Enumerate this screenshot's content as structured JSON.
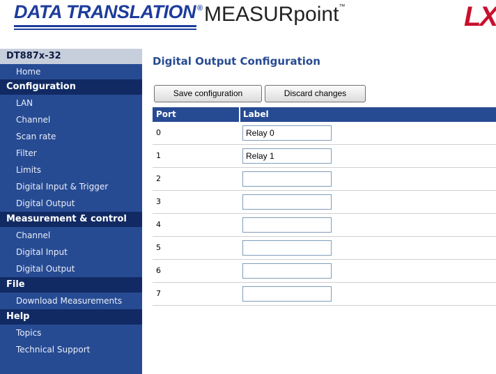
{
  "header": {
    "brand_datatranslation": "DATA TRANSLATION",
    "brand_registered": "®",
    "brand_product": "MEASURpoint",
    "brand_tm": "™",
    "brand_lxi": "LXI"
  },
  "sidebar": {
    "device": "DT887x-32",
    "home": "Home",
    "sections": [
      {
        "title": "Configuration",
        "items": [
          "LAN",
          "Channel",
          "Scan rate",
          "Filter",
          "Limits",
          "Digital Input & Trigger",
          "Digital Output"
        ]
      },
      {
        "title": "Measurement & control",
        "items": [
          "Channel",
          "Digital Input",
          "Digital Output"
        ]
      },
      {
        "title": "File",
        "items": [
          "Download Measurements"
        ]
      },
      {
        "title": "Help",
        "items": [
          "Topics",
          "Technical Support"
        ]
      }
    ]
  },
  "main": {
    "title": "Digital Output Configuration",
    "save_label": "Save configuration",
    "discard_label": "Discard changes",
    "columns": [
      "Port",
      "Label"
    ],
    "rows": [
      {
        "port": "0",
        "label": "Relay 0"
      },
      {
        "port": "1",
        "label": "Relay 1"
      },
      {
        "port": "2",
        "label": ""
      },
      {
        "port": "3",
        "label": ""
      },
      {
        "port": "4",
        "label": ""
      },
      {
        "port": "5",
        "label": ""
      },
      {
        "port": "6",
        "label": ""
      },
      {
        "port": "7",
        "label": ""
      }
    ]
  },
  "colors": {
    "sidebar_bg": "#274b93",
    "section_bg": "#112a63",
    "title_bg": "#c7cedc",
    "brand_blue": "#1d3c9c",
    "lxi_red": "#c8102e"
  }
}
